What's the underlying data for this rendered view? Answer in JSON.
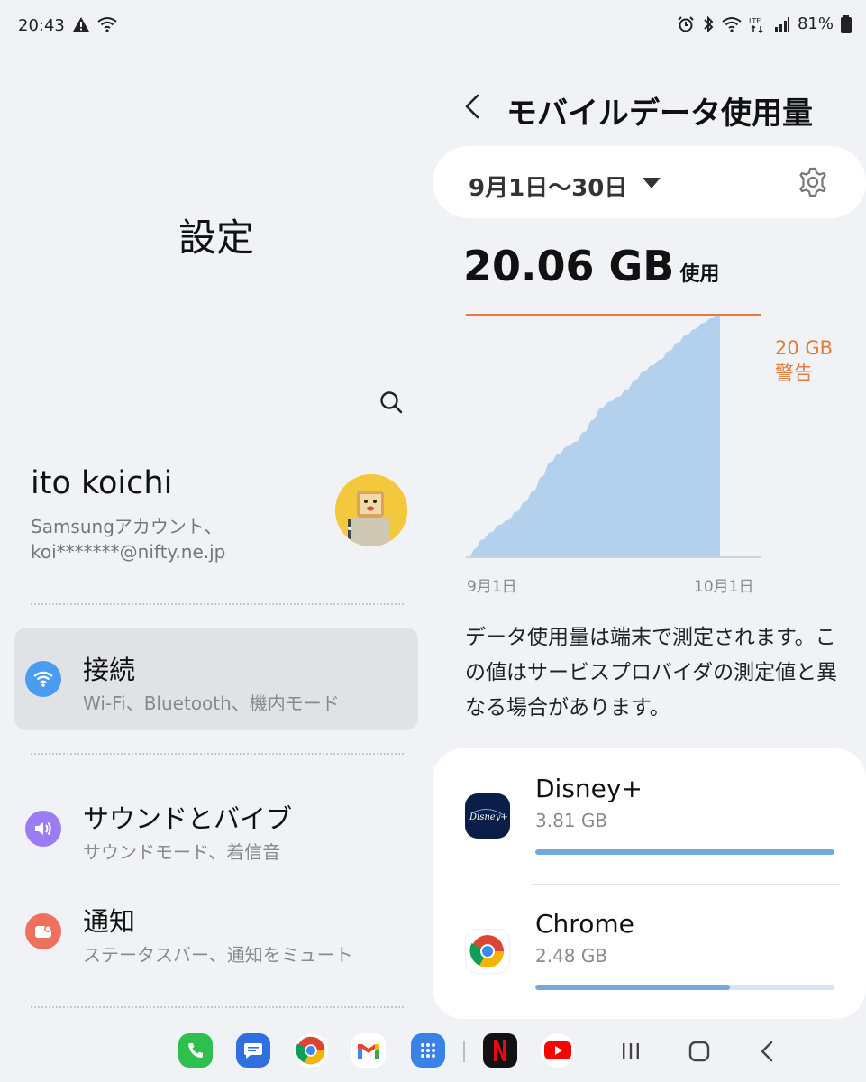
{
  "status_bar": {
    "time": "20:43",
    "battery": "81%",
    "left_icons": [
      "warning-icon",
      "wifi-icon"
    ],
    "right_icons": [
      "alarm-icon",
      "bluetooth-icon",
      "wifi-icon",
      "lte-icon",
      "signal-icon",
      "battery-icon"
    ]
  },
  "left": {
    "title": "設定",
    "profile": {
      "name": "ito koichi",
      "account_line": "Samsungアカウント、",
      "email": "koi*******@nifty.ne.jp"
    },
    "menu": [
      {
        "title": "接続",
        "subtitle": "Wi-Fi、Bluetooth、機内モード",
        "icon": "wifi-icon",
        "color": "#4a9cf0",
        "selected": true
      },
      {
        "title": "サウンドとバイブ",
        "subtitle": "サウンドモード、着信音",
        "icon": "speaker-icon",
        "color": "#9b7cf2",
        "selected": false
      },
      {
        "title": "通知",
        "subtitle": "ステータスバー、通知をミュート",
        "icon": "notification-icon",
        "color": "#f07060",
        "selected": false
      }
    ]
  },
  "right": {
    "title": "モバイルデータ使用量",
    "period": "9月1日〜30日",
    "usage_value": "20.06 GB",
    "usage_suffix": "使用",
    "warning_line1": "20 GB",
    "warning_line2": "警告",
    "x_start": "9月1日",
    "x_end": "10月1日",
    "notice": "データ使用量は端末で測定されます。この値はサービスプロバイダの測定値と異なる場合があります。",
    "apps": [
      {
        "name": "Disney+",
        "size": "3.81 GB",
        "usage_fraction": 1.0,
        "icon": "disney-plus-icon"
      },
      {
        "name": "Chrome",
        "size": "2.48 GB",
        "usage_fraction": 0.65,
        "icon": "chrome-icon"
      }
    ]
  },
  "chart_data": {
    "type": "area",
    "x": [
      "9月1日",
      "9月2日",
      "9月3日",
      "9月4日",
      "9月5日",
      "9月6日",
      "9月7日",
      "9月8日",
      "9月9日",
      "9月10日",
      "9月11日",
      "9月12日",
      "9月13日",
      "9月14日",
      "9月15日",
      "9月16日",
      "9月17日",
      "9月18日",
      "9月19日",
      "9月20日",
      "9月21日",
      "9月22日",
      "9月23日",
      "9月24日",
      "9月25日",
      "9月26日",
      "9月27日",
      "9月28日",
      "9月29日",
      "9月30日"
    ],
    "values": [
      0.6,
      1.4,
      2.0,
      2.6,
      3.0,
      3.7,
      4.5,
      5.4,
      6.6,
      7.8,
      8.5,
      9.1,
      9.5,
      10.3,
      11.3,
      12.3,
      12.8,
      13.2,
      13.8,
      14.6,
      15.3,
      15.8,
      16.3,
      17.0,
      17.7,
      18.3,
      18.8,
      19.3,
      19.7,
      20.06
    ],
    "xlim_labels": [
      "9月1日",
      "10月1日"
    ],
    "ylim": [
      0,
      20
    ],
    "threshold": {
      "value": 20,
      "label": "20 GB 警告",
      "color": "#e07c3c"
    },
    "fill_color": "#b3d0ec",
    "grid": false
  },
  "dock": {
    "apps": [
      "phone-icon",
      "messages-icon",
      "chrome-icon",
      "gmail-icon",
      "apps-grid-icon",
      "netflix-icon",
      "youtube-icon"
    ],
    "nav": [
      "recents-icon",
      "home-icon",
      "back-icon"
    ]
  }
}
